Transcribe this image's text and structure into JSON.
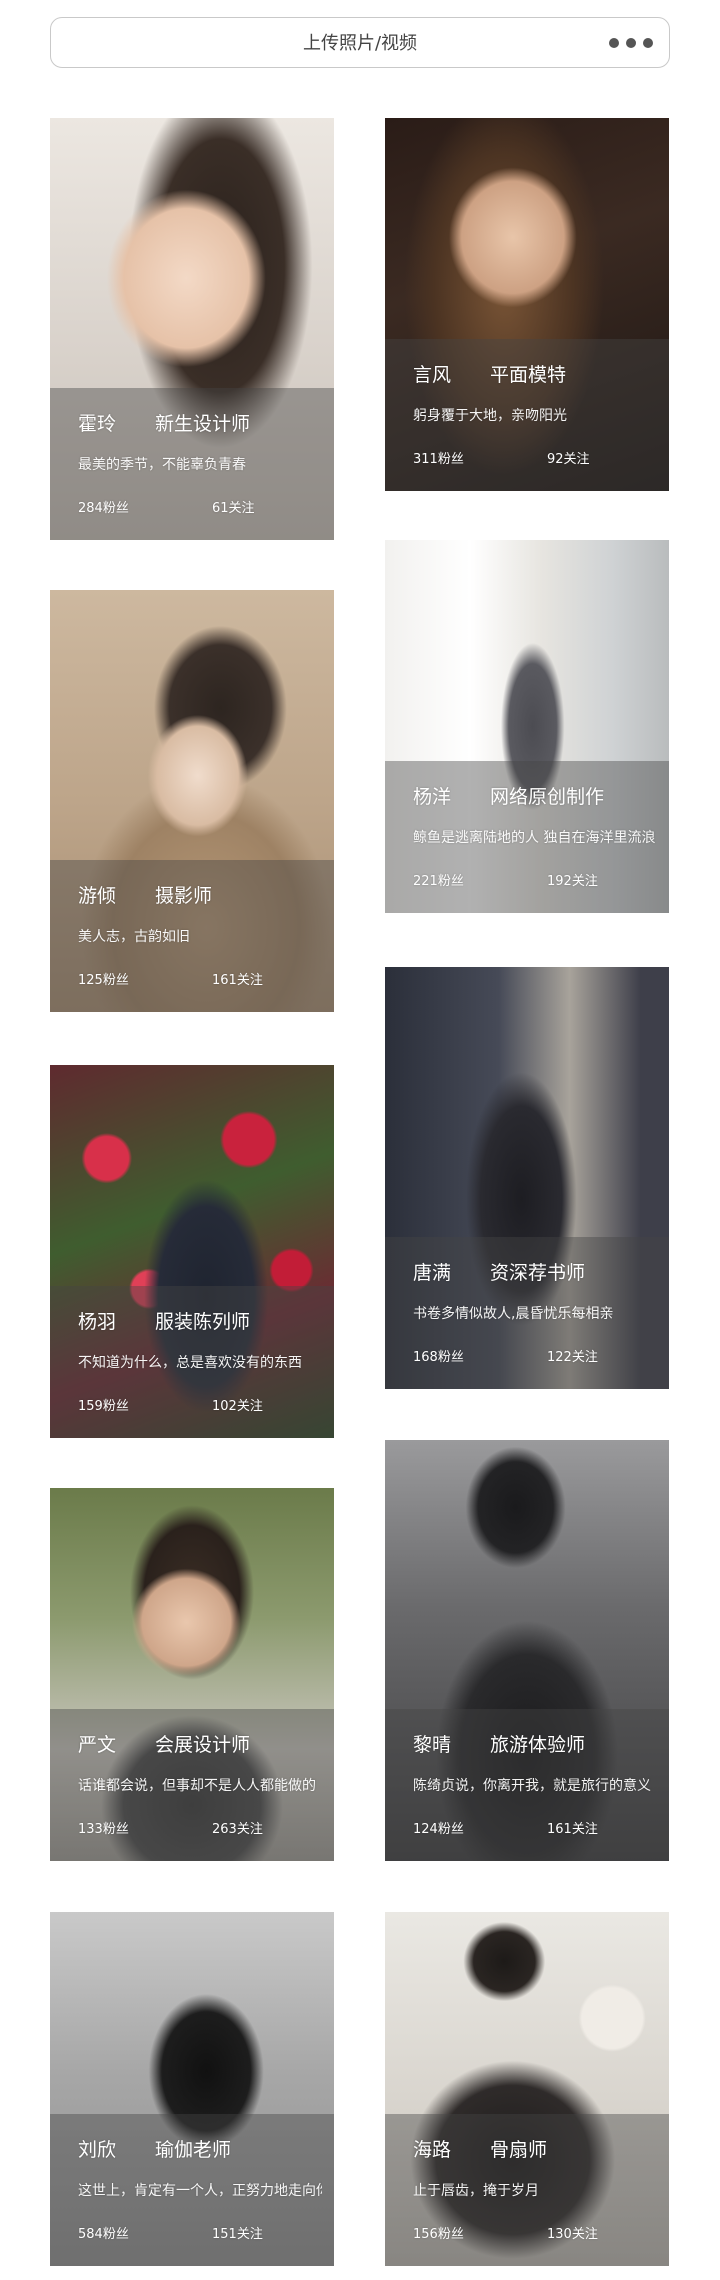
{
  "header": {
    "title": "上传照片/视频",
    "more_icon": "more-dots-icon"
  },
  "cards": [
    {
      "name": "霍玲",
      "role": "新生设计师",
      "motto": "最美的季节，不能辜负青春",
      "fans": "284粉丝",
      "follow": "61关注"
    },
    {
      "name": "言风",
      "role": "平面模特",
      "motto": "躬身覆于大地，亲吻阳光",
      "fans": "311粉丝",
      "follow": "92关注"
    },
    {
      "name": "游倾",
      "role": "摄影师",
      "motto": "美人志，古韵如旧",
      "fans": "125粉丝",
      "follow": "161关注"
    },
    {
      "name": "杨洋",
      "role": "网络原创制作",
      "motto": "鲸鱼是逃离陆地的人 独自在海洋里流浪",
      "fans": "221粉丝",
      "follow": "192关注"
    },
    {
      "name": "杨羽",
      "role": "服装陈列师",
      "motto": "不知道为什么，总是喜欢没有的东西",
      "fans": "159粉丝",
      "follow": "102关注"
    },
    {
      "name": "唐满",
      "role": "资深荐书师",
      "motto": "书卷多情似故人,晨昏忧乐每相亲",
      "fans": "168粉丝",
      "follow": "122关注"
    },
    {
      "name": "严文",
      "role": "会展设计师",
      "motto": "话谁都会说，但事却不是人人都能做的",
      "fans": "133粉丝",
      "follow": "263关注"
    },
    {
      "name": "黎晴",
      "role": "旅游体验师",
      "motto": "陈绮贞说，你离开我，就是旅行的意义",
      "fans": "124粉丝",
      "follow": "161关注"
    },
    {
      "name": "刘欣",
      "role": "瑜伽老师",
      "motto": "这世上，肯定有一个人，正努力地走向你",
      "fans": "584粉丝",
      "follow": "151关注"
    },
    {
      "name": "海路",
      "role": "骨扇师",
      "motto": "止于唇齿，掩于岁月",
      "fans": "156粉丝",
      "follow": "130关注"
    }
  ]
}
